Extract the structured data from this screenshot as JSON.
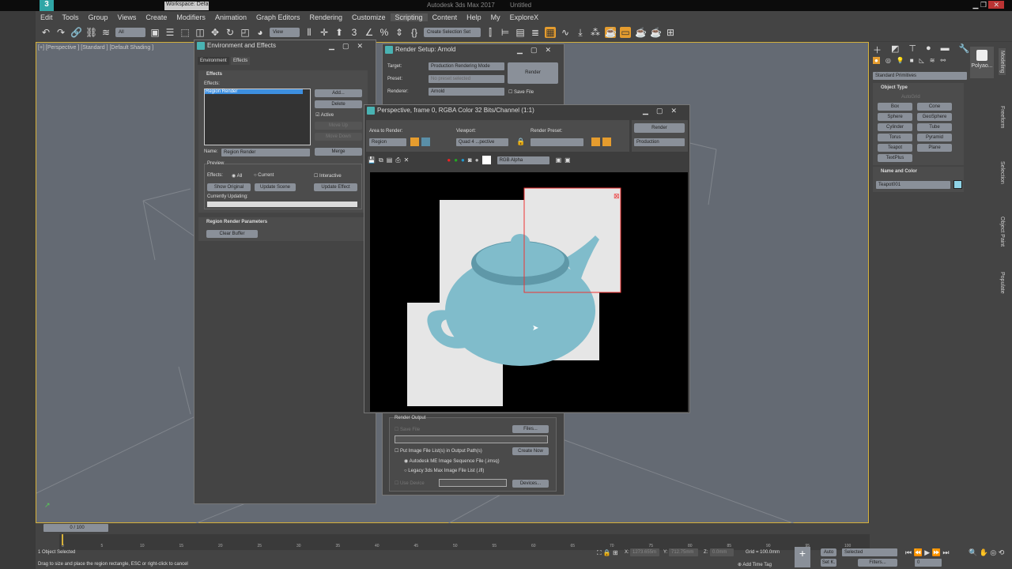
{
  "app": {
    "title": "Autodesk 3ds Max 2017",
    "doc": "Untitled",
    "workspace": "Workspace: Default"
  },
  "menu": [
    "Edit",
    "Tools",
    "Group",
    "Views",
    "Create",
    "Modifiers",
    "Animation",
    "Graph Editors",
    "Rendering",
    "Customize",
    "Scripting",
    "Content",
    "Help",
    "My",
    "ExploreX"
  ],
  "toolbar": {
    "filter": "All",
    "coord": "View",
    "selection_set": "Create Selection Set"
  },
  "viewport": {
    "label": "[+] [Perspective ] [Standard ] [Default Shading ]"
  },
  "env": {
    "title": "Environment and Effects",
    "tabs": [
      "Environment",
      "Effects"
    ],
    "section": "Effects",
    "effects_label": "Effects:",
    "effects_list": [
      "Region Render"
    ],
    "add": "Add...",
    "delete": "Delete",
    "active": "Active",
    "move_up": "Move Up",
    "move_down": "Move Down",
    "name_label": "Name:",
    "name_value": "Region Render",
    "merge": "Merge",
    "preview": "Preview",
    "effects_opt": "Effects:",
    "all": "All",
    "current": "Current",
    "interactive": "Interactive",
    "show_original": "Show Original",
    "update_scene": "Update Scene",
    "update_effect": "Update Effect",
    "currently_updating": "Currently Updating:",
    "params": "Region Render Parameters",
    "clear_buffer": "Clear Buffer"
  },
  "setup": {
    "title": "Render Setup: Arnold",
    "target_label": "Target:",
    "target": "Production Rendering Mode",
    "preset_label": "Preset:",
    "preset": "No preset selected",
    "renderer_label": "Renderer:",
    "renderer": "Arnold",
    "save_file": "Save File",
    "render": "Render",
    "render_output": "Render Output",
    "save_file2": "Save File",
    "files": "Files...",
    "put_list": "Put Image File List(s) in Output Path(s)",
    "create_now": "Create Now",
    "imsq": "Autodesk ME Image Sequence File (.imsq)",
    "ifl": "Legacy 3ds Max Image File List (.ifl)",
    "use_device": "Use Device",
    "devices": "Devices..."
  },
  "frame": {
    "title": "Perspective, frame 0, RGBA Color 32 Bits/Channel (1:1)",
    "area_label": "Area to Render:",
    "area": "Region",
    "viewport_label": "Viewport:",
    "viewport": "Quad 4 ...pective",
    "preset_label": "Render Preset:",
    "render": "Render",
    "mode": "Production",
    "channel": "RGB Alpha"
  },
  "cmd": {
    "category": "Standard Primitives",
    "object_type": "Object Type",
    "autogrid": "AutoGrid",
    "prims": [
      "Box",
      "Cone",
      "Sphere",
      "GeoSphere",
      "Cylinder",
      "Tube",
      "Torus",
      "Pyramid",
      "Teapot",
      "Plane",
      "TextPlus"
    ],
    "name_color": "Name and Color",
    "name": "Teapot001",
    "object_color": "#8fd3e6",
    "polyao": "Polyao...",
    "tabs": [
      "Modeling",
      "Freeform",
      "Selection",
      "Object Paint",
      "Populate"
    ]
  },
  "timeline": {
    "frame": "0 / 100",
    "ticks": [
      "0",
      "5",
      "10",
      "15",
      "20",
      "25",
      "30",
      "35",
      "40",
      "45",
      "50",
      "55",
      "60",
      "65",
      "70",
      "75",
      "80",
      "85",
      "90",
      "95",
      "100"
    ]
  },
  "status": {
    "selected": "1 Object Selected",
    "prompt": "Drag to size and place the region rectangle, ESC or right-click to cancel",
    "x": "1273.655m",
    "y": "712.75mm",
    "z": "0.0mm",
    "grid": "Grid = 100.0mm",
    "add_time_tag": "Add Time Tag",
    "auto": "Auto",
    "set_key": "Set K.",
    "key_mode": "Selected",
    "filters": "Filters...",
    "frame_field": "0"
  }
}
